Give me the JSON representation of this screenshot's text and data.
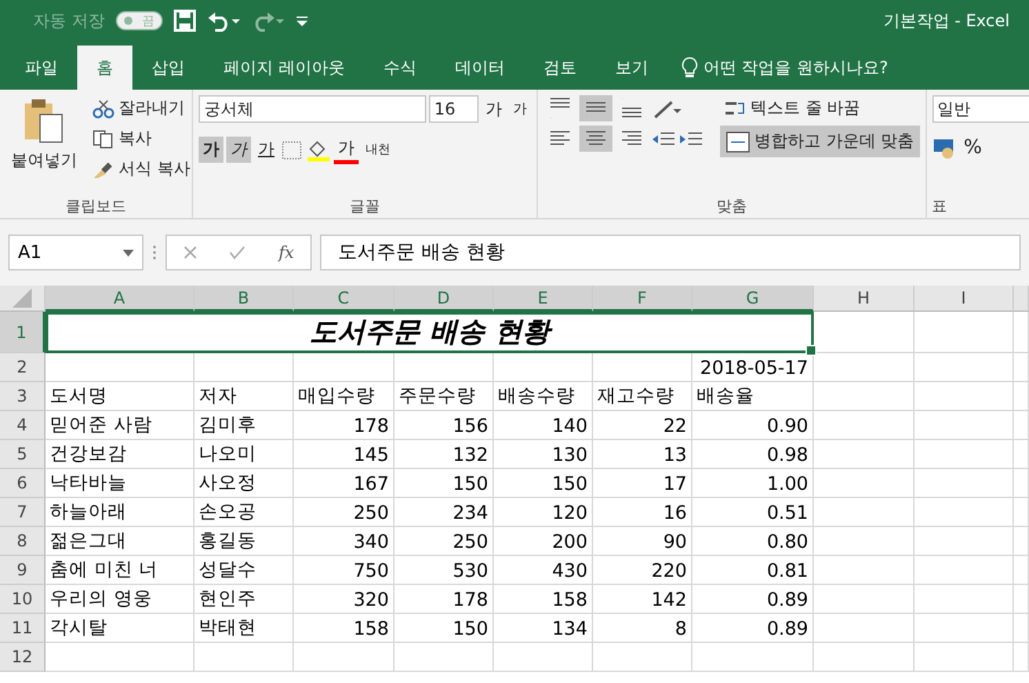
{
  "title_bar": {
    "autosave_label": "자동 저장",
    "autosave_toggle": {
      "label": "끔",
      "on": false
    },
    "title": "기본작업  -  Excel"
  },
  "tabs": [
    {
      "label": "파일",
      "selected": false
    },
    {
      "label": "홈",
      "selected": true
    },
    {
      "label": "삽입",
      "selected": false
    },
    {
      "label": "페이지 레이아웃",
      "selected": false
    },
    {
      "label": "수식",
      "selected": false
    },
    {
      "label": "데이터",
      "selected": false
    },
    {
      "label": "검토",
      "selected": false
    },
    {
      "label": "보기",
      "selected": false
    }
  ],
  "tell_me": "어떤 작업을 원하시나요?",
  "ribbon": {
    "clipboard": {
      "paste": "붙여넣기",
      "cut": "잘라내기",
      "copy": "복사",
      "format_painter": "서식 복사",
      "group": "클립보드"
    },
    "font": {
      "name": "궁서체",
      "size": "16",
      "grow": "가",
      "shrink": "가",
      "styles": [
        {
          "label": "가",
          "kind": "bold",
          "selected": true
        },
        {
          "label": "가",
          "kind": "italic",
          "selected": true
        },
        {
          "label": "가",
          "kind": "underline",
          "selected": false
        }
      ],
      "font_color_label": "가",
      "phonetic": "내천",
      "group": "글꼴"
    },
    "alignment": {
      "vertical": [
        {
          "kind": "top",
          "selected": false
        },
        {
          "kind": "middle",
          "selected": true
        },
        {
          "kind": "bottom",
          "selected": false
        }
      ],
      "horizontal": [
        {
          "kind": "left",
          "selected": false
        },
        {
          "kind": "center",
          "selected": true
        },
        {
          "kind": "right",
          "selected": false
        }
      ],
      "wrap_text": "텍스트 줄 바꿈",
      "merge": {
        "label": "병합하고 가운데 맞춤",
        "selected": true
      },
      "group": "맞춤"
    },
    "number": {
      "format": "일반",
      "percent": "%",
      "group": "표"
    }
  },
  "formula_bar": {
    "name_box": "A1",
    "fx": "fx",
    "content": "도서주문 배송 현황"
  },
  "sheet": {
    "columns": [
      "A",
      "B",
      "C",
      "D",
      "E",
      "F",
      "G",
      "H",
      "I"
    ],
    "rows": [
      {
        "number": "1",
        "kind": "title",
        "cells": [
          {
            "text": "도서주문 배송 현황",
            "colspan": 7
          }
        ]
      },
      {
        "number": "2",
        "kind": "date",
        "cells": [
          "",
          "",
          "",
          "",
          "",
          "",
          "2018-05-17"
        ]
      },
      {
        "number": "3",
        "kind": "header",
        "cells": [
          "도서명",
          "저자",
          "매입수량",
          "주문수량",
          "배송수량",
          "재고수량",
          "배송율"
        ]
      },
      {
        "number": "4",
        "kind": "data",
        "cells": [
          "믿어준 사람",
          "김미후",
          "178",
          "156",
          "140",
          "22",
          "0.90"
        ]
      },
      {
        "number": "5",
        "kind": "data",
        "cells": [
          "건강보감",
          "나오미",
          "145",
          "132",
          "130",
          "13",
          "0.98"
        ]
      },
      {
        "number": "6",
        "kind": "data",
        "cells": [
          "낙타바늘",
          "사오정",
          "167",
          "150",
          "150",
          "17",
          "1.00"
        ]
      },
      {
        "number": "7",
        "kind": "data",
        "cells": [
          "하늘아래",
          "손오공",
          "250",
          "234",
          "120",
          "16",
          "0.51"
        ]
      },
      {
        "number": "8",
        "kind": "data",
        "cells": [
          "젊은그대",
          "홍길동",
          "340",
          "250",
          "200",
          "90",
          "0.80"
        ]
      },
      {
        "number": "9",
        "kind": "data",
        "cells": [
          "춤에 미친 너",
          "성달수",
          "750",
          "530",
          "430",
          "220",
          "0.81"
        ]
      },
      {
        "number": "10",
        "kind": "data",
        "cells": [
          "우리의 영웅",
          "현인주",
          "320",
          "178",
          "158",
          "142",
          "0.89"
        ]
      },
      {
        "number": "11",
        "kind": "data",
        "cells": [
          "각시탈",
          "박태현",
          "158",
          "150",
          "134",
          "8",
          "0.89"
        ]
      },
      {
        "number": "12",
        "kind": "empty",
        "cells": []
      }
    ]
  }
}
